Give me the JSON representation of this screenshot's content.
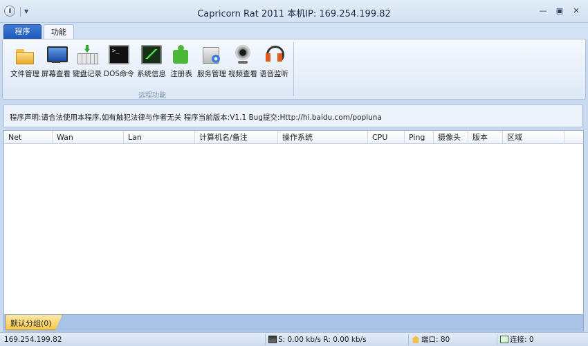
{
  "window": {
    "title": "Capricorn Rat 2011    本机IP: 169.254.199.82",
    "controls": [
      "minimize-icon",
      "maximize-icon",
      "close-icon"
    ]
  },
  "ribbon": {
    "tabs": [
      {
        "label": "程序",
        "active": false
      },
      {
        "label": "功能",
        "active": true
      }
    ],
    "group_label": "远程功能",
    "buttons": [
      {
        "label": "文件管理",
        "icon": "folder-icon"
      },
      {
        "label": "屏幕查看",
        "icon": "monitor-icon"
      },
      {
        "label": "键盘记录",
        "icon": "keyboard-icon"
      },
      {
        "label": "DOS命令",
        "icon": "command-prompt-icon"
      },
      {
        "label": "系统信息",
        "icon": "system-monitor-icon"
      },
      {
        "label": "注册表",
        "icon": "puzzle-icon"
      },
      {
        "label": "服务管理",
        "icon": "service-gear-icon"
      },
      {
        "label": "视频查看",
        "icon": "webcam-icon"
      },
      {
        "label": "语音监听",
        "icon": "headset-icon"
      }
    ]
  },
  "notice": "程序声明:请合法使用本程序,如有触犯法律与作者无关 程序当前版本:V1.1 Bug提交:Http://hi.baidu.com/popluna",
  "table": {
    "columns": [
      "Net",
      "Wan",
      "Lan",
      "计算机名/备注",
      "操作系统",
      "CPU",
      "Ping",
      "摄像头",
      "版本",
      "区域"
    ],
    "rows": []
  },
  "group_tab": "默认分组(0)",
  "statusbar": {
    "ip": "169.254.199.82",
    "speed": "S: 0.00 kb/s R: 0.00 kb/s",
    "port": "端口: 80",
    "connections": "连接: 0"
  },
  "colors": {
    "accent": "#1e5bbd",
    "window_bg": "#c9daf0",
    "group_tab": "#f6c94f"
  }
}
